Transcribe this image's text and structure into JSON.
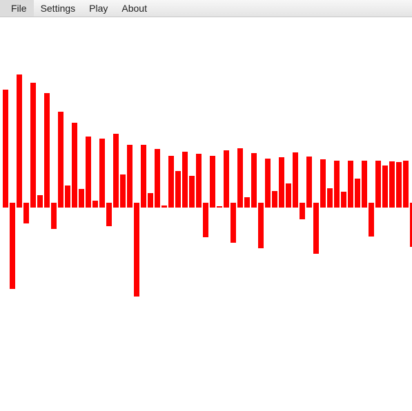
{
  "menu": {
    "file": "File",
    "settings": "Settings",
    "play": "Play",
    "about": "About"
  },
  "colors": {
    "bar": "#ff0000",
    "background": "#ffffff"
  },
  "chart_data": {
    "type": "bar",
    "grid": false,
    "legend": "none",
    "ylim": [
      -140,
      200
    ],
    "values": [
      171,
      -118,
      193,
      -23,
      181,
      18,
      166,
      -31,
      139,
      32,
      123,
      27,
      103,
      10,
      100,
      -27,
      107,
      48,
      91,
      -129,
      91,
      21,
      85,
      3,
      75,
      53,
      81,
      46,
      78,
      -43,
      75,
      2,
      83,
      -51,
      86,
      15,
      79,
      -59,
      71,
      24,
      73,
      35,
      80,
      -17,
      74,
      -67,
      70,
      28,
      68,
      23,
      68,
      42,
      68,
      -42,
      68,
      61,
      67,
      66,
      68,
      -57
    ]
  }
}
